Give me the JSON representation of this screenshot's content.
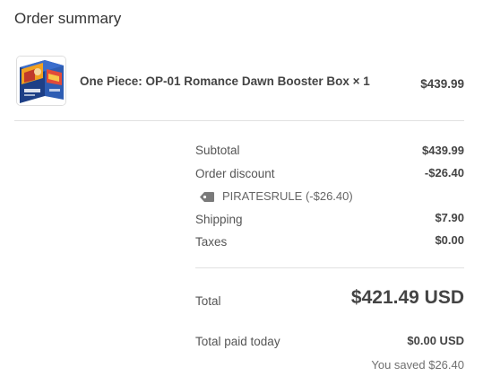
{
  "summary": {
    "title": "Order summary"
  },
  "product": {
    "name": "One Piece: OP-01 Romance Dawn Booster Box × 1",
    "price": "$439.99",
    "image_icon": "booster-box-thumbnail"
  },
  "totals": {
    "subtotal_label": "Subtotal",
    "subtotal_value": "$439.99",
    "discount_label": "Order discount",
    "discount_value": "-$26.40",
    "discount_code": "PIRATESRULE (-$26.40)",
    "discount_icon": "price-tag-icon",
    "shipping_label": "Shipping",
    "shipping_value": "$7.90",
    "taxes_label": "Taxes",
    "taxes_value": "$0.00",
    "total_label": "Total",
    "total_value": "$421.49 USD",
    "paid_label": "Total paid today",
    "paid_value": "$0.00 USD",
    "saved_text": "You saved $26.40"
  },
  "colors": {
    "text_primary": "#333333",
    "text_secondary": "#555555",
    "divider": "#e1e1e1",
    "tag_icon": "#7a7a7a"
  }
}
